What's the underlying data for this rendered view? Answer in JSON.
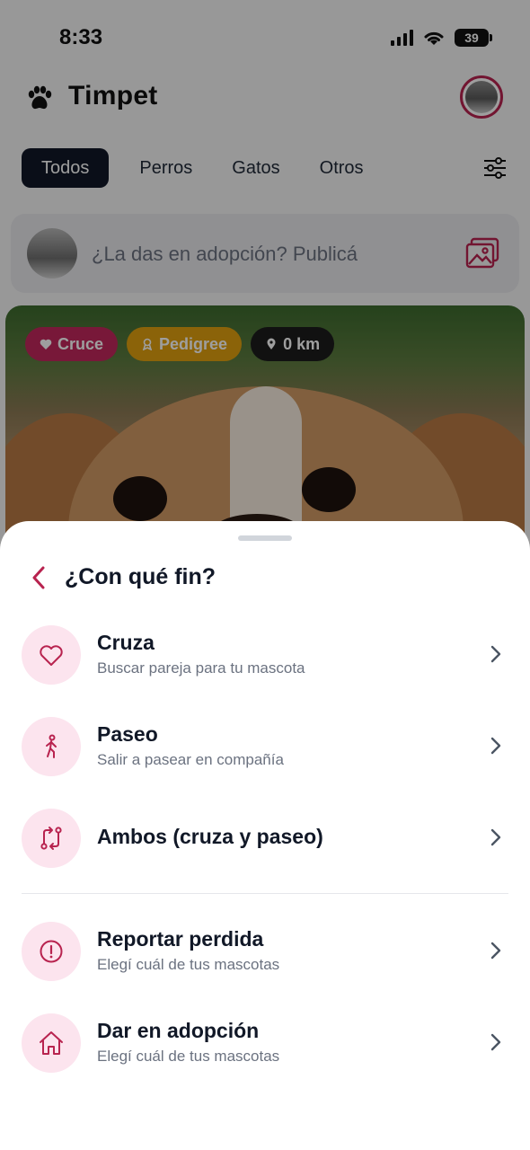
{
  "status_bar": {
    "time": "8:33",
    "battery": "39"
  },
  "app": {
    "title": "Timpet"
  },
  "tabs": [
    {
      "label": "Todos",
      "active": true
    },
    {
      "label": "Perros",
      "active": false
    },
    {
      "label": "Gatos",
      "active": false
    },
    {
      "label": "Otros",
      "active": false
    }
  ],
  "compose": {
    "placeholder": "¿La das en adopción? Publicá"
  },
  "post": {
    "badges": [
      {
        "label": "Cruce",
        "icon": "heart-icon"
      },
      {
        "label": "Pedigree",
        "icon": "award-icon"
      },
      {
        "label": "0 km",
        "icon": "location-pin-icon"
      }
    ]
  },
  "sheet": {
    "title": "¿Con qué fin?",
    "options": [
      {
        "title": "Cruza",
        "subtitle": "Buscar pareja para tu mascota",
        "icon": "heart-icon"
      },
      {
        "title": "Paseo",
        "subtitle": "Salir a pasear en compañía",
        "icon": "walking-person-icon"
      },
      {
        "title": "Ambos (cruza y paseo)",
        "subtitle": "",
        "icon": "swap-arrows-icon"
      },
      {
        "title": "Reportar perdida",
        "subtitle": "Elegí cuál de tus mascotas",
        "icon": "alert-circle-icon"
      },
      {
        "title": "Dar en adopción",
        "subtitle": "Elegí cuál de tus mascotas",
        "icon": "home-icon"
      }
    ]
  },
  "colors": {
    "accent": "#b8234f",
    "icon_bg": "#fce4ee",
    "dark": "#111827"
  }
}
